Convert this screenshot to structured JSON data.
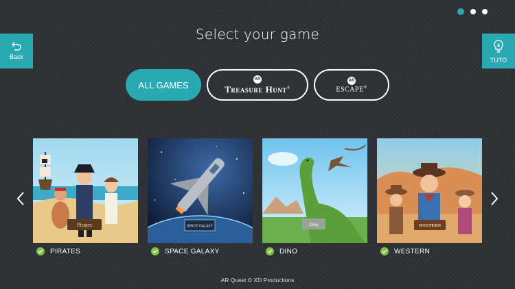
{
  "colors": {
    "accent": "#29a9b1",
    "background": "#2e3135",
    "check": "#7fc241"
  },
  "page_indicator": {
    "count": 3,
    "active": 0
  },
  "back_button": {
    "label": "Back",
    "icon": "back-arrow-icon"
  },
  "tuto_button": {
    "label": "TUTO",
    "icon": "lightbulb-icon"
  },
  "title": "Select your game",
  "filters": {
    "all": {
      "label": "ALL GAMES"
    },
    "treasure_hunt": {
      "badge": "AR",
      "label": "Treasure Hunt",
      "mark": "®"
    },
    "escape": {
      "badge": "AR",
      "label": "ESCAPE",
      "mark": "®"
    }
  },
  "games": [
    {
      "label": "PIRATES",
      "banner": "Pirates"
    },
    {
      "label": "SPACE GALAXY",
      "banner": "SPACE GALAXY"
    },
    {
      "label": "DINO",
      "banner": "Dino"
    },
    {
      "label": "WESTERN",
      "banner": "WESTERN"
    }
  ],
  "footer": "AR Quest © XD Productions"
}
